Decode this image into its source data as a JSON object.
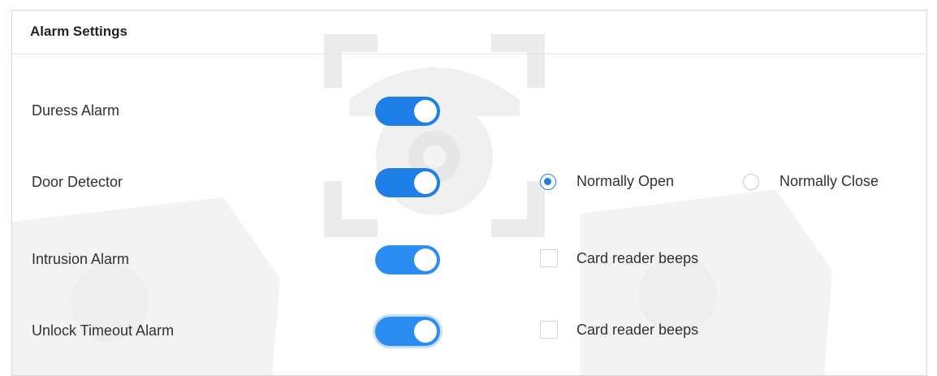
{
  "panel": {
    "title": "Alarm Settings"
  },
  "rows": [
    {
      "label": "Duress Alarm",
      "toggle_on": true
    },
    {
      "label": "Door Detector",
      "toggle_on": true,
      "options": [
        {
          "label": "Normally Open",
          "selected": true
        },
        {
          "label": "Normally Close",
          "selected": false
        }
      ]
    },
    {
      "label": "Intrusion Alarm",
      "toggle_on": true,
      "checkbox_label": "Card reader beeps",
      "checked": false
    },
    {
      "label": "Unlock Timeout Alarm",
      "toggle_on": true,
      "checkbox_label": "Card reader beeps",
      "checked": false
    }
  ],
  "colors": {
    "accent": "#1e7fe8",
    "text": "#303133",
    "border": "#d9d9d9"
  },
  "icons": [
    "security-camera-watermark"
  ]
}
